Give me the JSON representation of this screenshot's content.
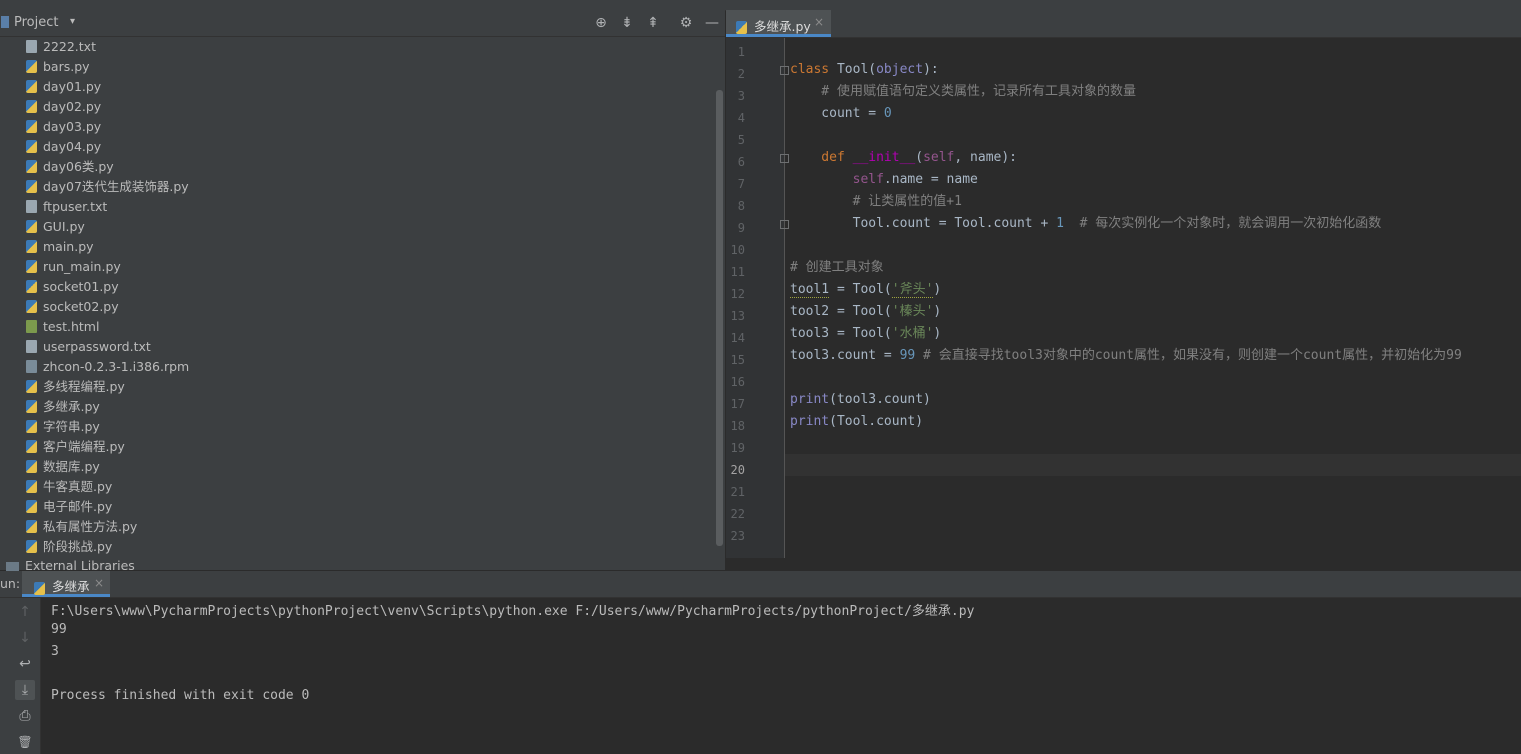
{
  "project": {
    "title": "Project",
    "files": [
      {
        "name": "2222.txt",
        "type": "txt"
      },
      {
        "name": "bars.py",
        "type": "py"
      },
      {
        "name": "day01.py",
        "type": "py"
      },
      {
        "name": "day02.py",
        "type": "py"
      },
      {
        "name": "day03.py",
        "type": "py"
      },
      {
        "name": "day04.py",
        "type": "py"
      },
      {
        "name": "day06类.py",
        "type": "py"
      },
      {
        "name": "day07迭代生成装饰器.py",
        "type": "py"
      },
      {
        "name": "ftpuser.txt",
        "type": "txt"
      },
      {
        "name": "GUI.py",
        "type": "py"
      },
      {
        "name": "main.py",
        "type": "py"
      },
      {
        "name": "run_main.py",
        "type": "py"
      },
      {
        "name": "socket01.py",
        "type": "py"
      },
      {
        "name": "socket02.py",
        "type": "py"
      },
      {
        "name": "test.html",
        "type": "html"
      },
      {
        "name": "userpassword.txt",
        "type": "txt"
      },
      {
        "name": "zhcon-0.2.3-1.i386.rpm",
        "type": "rpm"
      },
      {
        "name": "多线程编程.py",
        "type": "py"
      },
      {
        "name": "多继承.py",
        "type": "py"
      },
      {
        "name": "字符串.py",
        "type": "py"
      },
      {
        "name": "客户端编程.py",
        "type": "py"
      },
      {
        "name": "数据库.py",
        "type": "py"
      },
      {
        "name": "牛客真题.py",
        "type": "py"
      },
      {
        "name": "电子邮件.py",
        "type": "py"
      },
      {
        "name": "私有属性方法.py",
        "type": "py"
      },
      {
        "name": "阶段挑战.py",
        "type": "py"
      }
    ],
    "external_libraries": "External Libraries"
  },
  "editor": {
    "tab_label": "多继承.py",
    "line_numbers": [
      "1",
      "2",
      "3",
      "4",
      "5",
      "6",
      "7",
      "8",
      "9",
      "10",
      "11",
      "12",
      "13",
      "14",
      "15",
      "16",
      "17",
      "18",
      "19",
      "20",
      "21",
      "22",
      "23"
    ],
    "code": {
      "l2_class": "class",
      "l2_name": " Tool(",
      "l2_base": "object",
      "l2_end": "):",
      "l3": "    # 使用赋值语句定义类属性，记录所有工具对象的数量",
      "l4_a": "    count = ",
      "l4_num": "0",
      "l6_def": "    def ",
      "l6_fn": "__init__",
      "l6_open": "(",
      "l6_self": "self",
      "l6_rest": ", name):",
      "l7_self": "        self",
      "l7_rest": ".name = name",
      "l8": "        # 让类属性的值+1",
      "l9_a": "        Tool.count = Tool.count + ",
      "l9_num": "1",
      "l9_cm": "  # 每次实例化一个对象时，就会调用一次初始化函数",
      "l11": "# 创建工具对象",
      "l12_var": "tool1",
      "l12_mid": " = Tool(",
      "l12_str": "'斧头'",
      "l12_end": ")",
      "l13_a": "tool2 = Tool(",
      "l13_str": "'榛头'",
      "l13_end": ")",
      "l14_a": "tool3 = Tool(",
      "l14_str": "'水桶'",
      "l14_end": ")",
      "l15_a": "tool3.count = ",
      "l15_num": "99",
      "l15_cm": " # 会直接寻找tool3对象中的count属性，如果没有，则创建一个count属性，并初始化为99",
      "l17_fn": "print",
      "l17_rest": "(tool3.count)",
      "l18_fn": "print",
      "l18_rest": "(Tool.count)"
    }
  },
  "run": {
    "label": "un:",
    "tab_label": "多继承",
    "output": [
      "F:\\Users\\www\\PycharmProjects\\pythonProject\\venv\\Scripts\\python.exe F:/Users/www/PycharmProjects/pythonProject/多继承.py",
      "99",
      "3",
      "",
      "Process finished with exit code 0"
    ]
  },
  "icons": {
    "locate": "⊕",
    "expand": "⇟",
    "collapse": "⇞",
    "settings": "⚙",
    "minimize": "—",
    "up": "↑",
    "down": "↓",
    "wrap": "↩",
    "scroll_end": "⤓",
    "print": "⎙",
    "trash": "🗑",
    "close": "×",
    "dropdown": "▾"
  },
  "colors": {
    "accent": "#4a88c7",
    "keyword": "#cc7832",
    "string": "#6a8759",
    "number": "#6897bb",
    "comment": "#808080"
  }
}
